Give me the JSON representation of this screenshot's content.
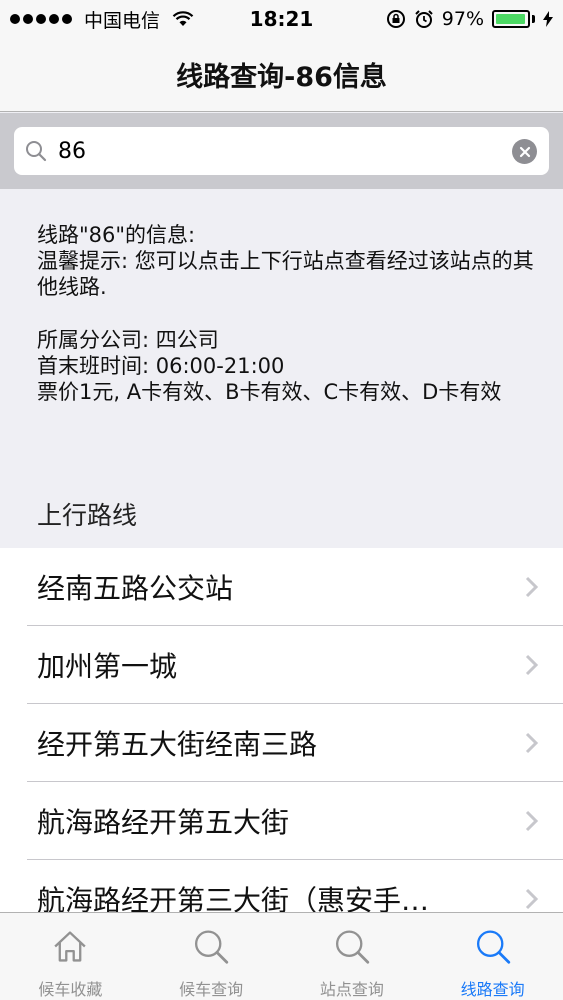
{
  "status_bar": {
    "carrier": "中国电信",
    "time": "18:21",
    "battery_percent": "97%",
    "battery_level": 0.97
  },
  "nav": {
    "title": "线路查询-86信息"
  },
  "search": {
    "value": "86"
  },
  "info": {
    "line1": "线路\"86\"的信息:",
    "line2": "温馨提示: 您可以点击上下行站点查看经过该站点的其他线路.",
    "company": "所属分公司: 四公司",
    "hours": "首末班时间: 06:00-21:00",
    "fare": "票价1元, A卡有效、B卡有效、C卡有效、D卡有效"
  },
  "section_header": "上行路线",
  "stops": [
    {
      "label": "经南五路公交站"
    },
    {
      "label": "加州第一城"
    },
    {
      "label": "经开第五大街经南三路"
    },
    {
      "label": "航海路经开第五大街"
    },
    {
      "label": "航海路经开第三大街（惠安手…"
    }
  ],
  "tabs": [
    {
      "label": "候车收藏",
      "icon": "home-icon",
      "active": false
    },
    {
      "label": "候车查询",
      "icon": "search-icon",
      "active": false
    },
    {
      "label": "站点查询",
      "icon": "search-icon",
      "active": false
    },
    {
      "label": "线路查询",
      "icon": "search-icon",
      "active": true
    }
  ],
  "colors": {
    "accent": "#1a7af8",
    "inactive": "#929292",
    "battery": "#4cd964"
  }
}
